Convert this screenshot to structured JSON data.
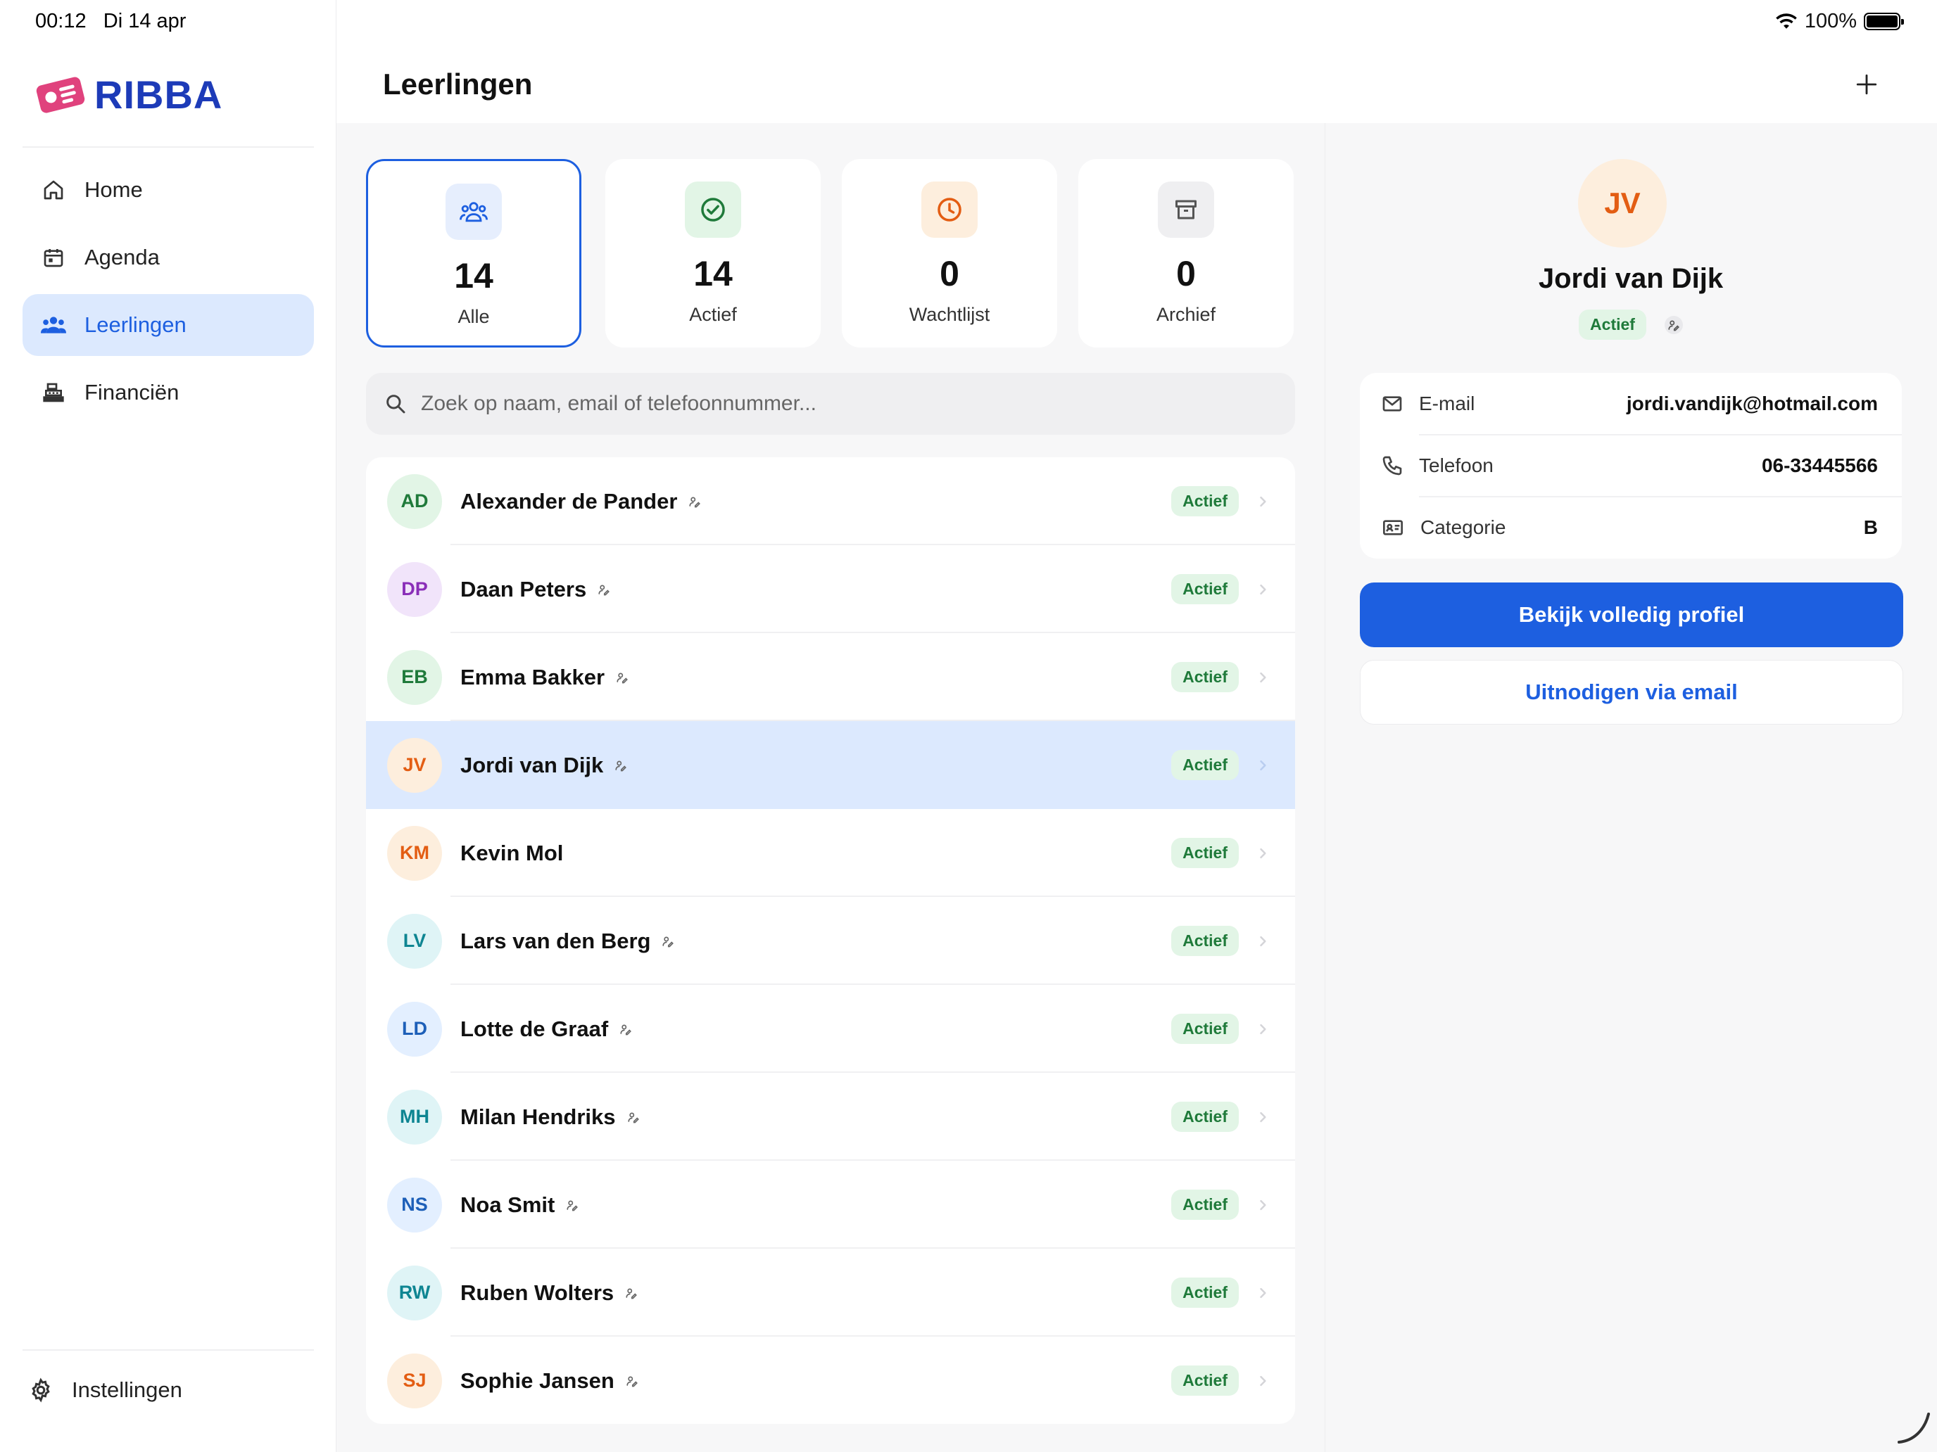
{
  "status_bar": {
    "time": "00:12",
    "date": "Di 14 apr",
    "battery": "100%"
  },
  "app": {
    "logo_text": "RIBBA",
    "brand_color": "#1d3bb8",
    "accent_color": "#1d5fe0"
  },
  "sidebar": {
    "items": [
      {
        "label": "Home",
        "icon": "home-icon"
      },
      {
        "label": "Agenda",
        "icon": "calendar-icon"
      },
      {
        "label": "Leerlingen",
        "icon": "users-icon",
        "active": true
      },
      {
        "label": "Financiën",
        "icon": "register-icon"
      }
    ],
    "settings_label": "Instellingen"
  },
  "header": {
    "title": "Leerlingen"
  },
  "stats": [
    {
      "value": "14",
      "label": "Alle",
      "icon": "users-icon",
      "active": true
    },
    {
      "value": "14",
      "label": "Actief",
      "icon": "check-circle-icon"
    },
    {
      "value": "0",
      "label": "Wachtlijst",
      "icon": "clock-icon"
    },
    {
      "value": "0",
      "label": "Archief",
      "icon": "archive-icon"
    }
  ],
  "search": {
    "placeholder": "Zoek op naam, email of telefoonnummer..."
  },
  "students": [
    {
      "initials": "AD",
      "name": "Alexander de Pander",
      "status": "Actief",
      "pen": true
    },
    {
      "initials": "DP",
      "name": "Daan Peters",
      "status": "Actief",
      "pen": true
    },
    {
      "initials": "EB",
      "name": "Emma Bakker",
      "status": "Actief",
      "pen": true
    },
    {
      "initials": "JV",
      "name": "Jordi van Dijk",
      "status": "Actief",
      "pen": true,
      "selected": true
    },
    {
      "initials": "KM",
      "name": "Kevin Mol",
      "status": "Actief",
      "pen": false
    },
    {
      "initials": "LV",
      "name": "Lars van den Berg",
      "status": "Actief",
      "pen": true
    },
    {
      "initials": "LD",
      "name": "Lotte de Graaf",
      "status": "Actief",
      "pen": true
    },
    {
      "initials": "MH",
      "name": "Milan Hendriks",
      "status": "Actief",
      "pen": true
    },
    {
      "initials": "NS",
      "name": "Noa Smit",
      "status": "Actief",
      "pen": true
    },
    {
      "initials": "RW",
      "name": "Ruben Wolters",
      "status": "Actief",
      "pen": true
    },
    {
      "initials": "SJ",
      "name": "Sophie Jansen",
      "status": "Actief",
      "pen": true
    }
  ],
  "detail": {
    "initials": "JV",
    "name": "Jordi van Dijk",
    "status": "Actief",
    "fields": [
      {
        "label": "E-mail",
        "value": "jordi.vandijk@hotmail.com",
        "icon": "mail-icon"
      },
      {
        "label": "Telefoon",
        "value": "06-33445566",
        "icon": "phone-icon"
      },
      {
        "label": "Categorie",
        "value": "B",
        "icon": "id-card-icon"
      }
    ],
    "primary_button": "Bekijk volledig profiel",
    "secondary_button": "Uitnodigen via email"
  }
}
